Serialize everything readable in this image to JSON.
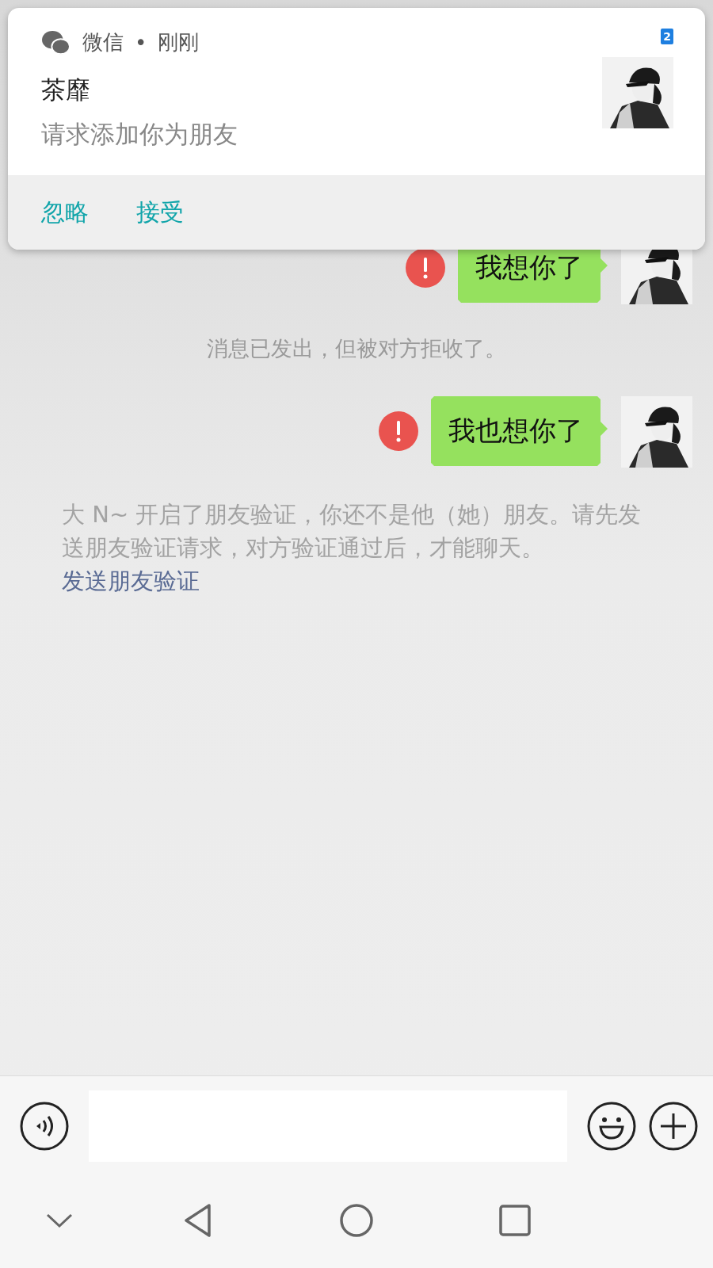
{
  "notification": {
    "app": "微信",
    "separator": "•",
    "time": "刚刚",
    "badge": "2",
    "sender": "茶靡",
    "message": "请求添加你为朋友",
    "actions": [
      "忽略",
      "接受"
    ]
  },
  "messages": [
    {
      "kind": "outgoing",
      "text": "我想你了",
      "failed": true
    },
    {
      "kind": "system",
      "text": "消息已发出，但被对方拒收了。"
    },
    {
      "kind": "outgoing",
      "text": "我也想你了",
      "failed": true
    },
    {
      "kind": "notice",
      "text": "大 N~ 开启了朋友验证，你还不是他（她）朋友。请先发送朋友验证请求，对方验证通过后，才能聊天。",
      "link": "发送朋友验证"
    }
  ]
}
